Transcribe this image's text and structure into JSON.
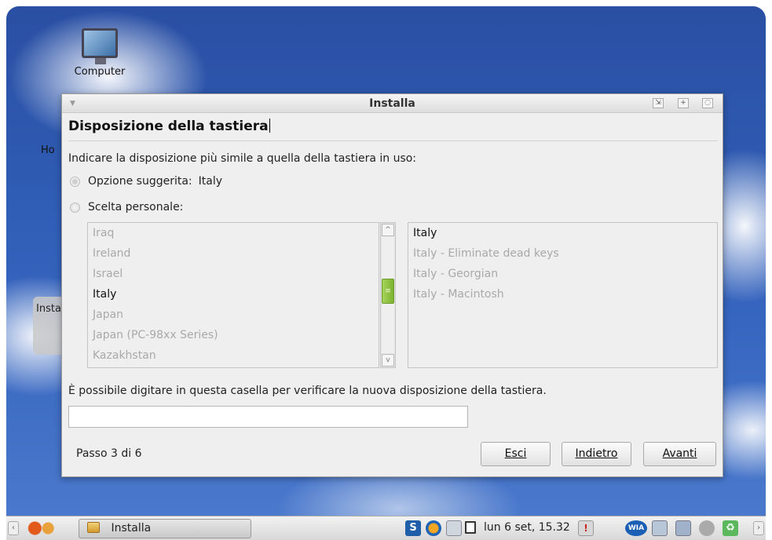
{
  "desktop": {
    "computer_label": "Computer",
    "home_fragment": "Ho",
    "install_fragment": "Insta"
  },
  "window": {
    "title": "Installa",
    "page_title": "Disposizione della tastiera",
    "instruction": "Indicare la disposizione più simile a quella della tastiera in uso:",
    "suggested_label": "Opzione suggerita:",
    "suggested_value": "Italy",
    "personal_label": "Scelta personale:",
    "countries": [
      "Iraq",
      "Ireland",
      "Israel",
      "Italy",
      "Japan",
      "Japan (PC-98xx Series)",
      "Kazakhstan"
    ],
    "selected_country": "Italy",
    "variants": [
      "Italy",
      "Italy - Eliminate dead keys",
      "Italy - Georgian",
      "Italy - Macintosh"
    ],
    "selected_variant": "Italy",
    "test_label": "È possibile digitare in questa casella per verificare la nuova disposizione della tastiera.",
    "test_value": "",
    "step": "Passo 3 di 6",
    "buttons": {
      "quit": "Esci",
      "back": "Indietro",
      "forward": "Avanti"
    }
  },
  "taskbar": {
    "task_label": "Installa",
    "clock": "lun  6 set, 15.32"
  },
  "colors": {
    "accent": "#8bc34a",
    "desktop_sky": "#2f5cb4"
  }
}
